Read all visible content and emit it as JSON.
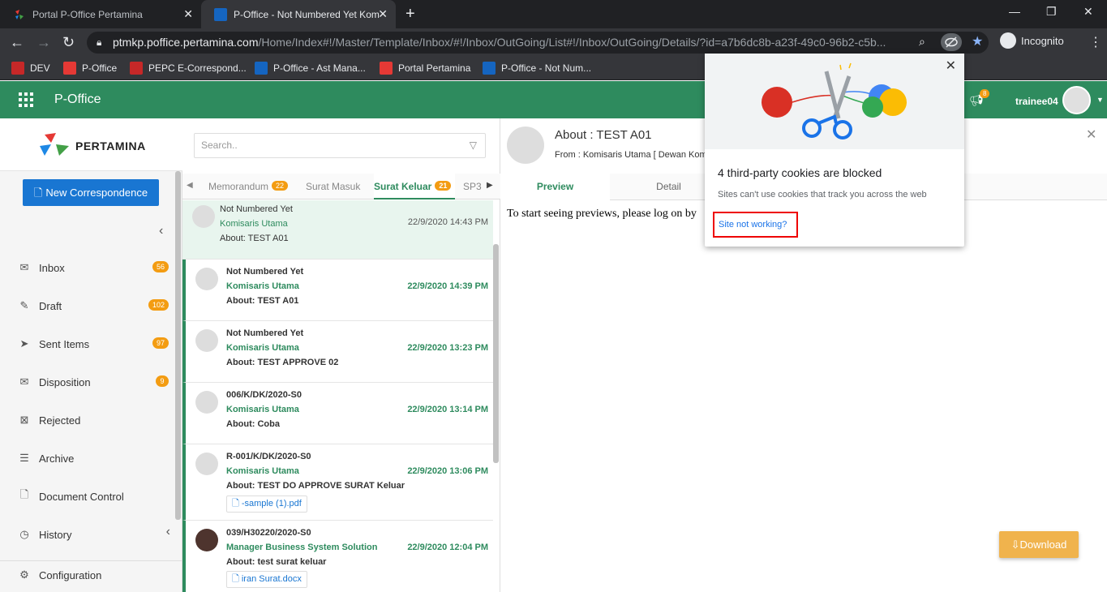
{
  "browser": {
    "tabs": [
      {
        "label": "Portal P-Office Pertamina"
      },
      {
        "label": "P-Office - Not Numbered Yet Kom"
      }
    ],
    "url_host": "ptmkp.poffice.pertamina.com",
    "url_path": "/Home/Index#!/Master/Template/Inbox/#!/Inbox/OutGoing/List#!/Inbox/OutGoing/Details/?id=a7b6dc8b-a23f-49c0-96b2-c5b...",
    "incognito_label": "Incognito",
    "bookmarks": [
      {
        "label": "DEV",
        "color": "#c62828"
      },
      {
        "label": "P-Office",
        "color": "#e53935"
      },
      {
        "label": "PEPC E-Correspond...",
        "color": "#c62828"
      },
      {
        "label": "P-Office - Ast Mana...",
        "color": "#1565c0"
      },
      {
        "label": "Portal Pertamina",
        "color": "#e53935"
      },
      {
        "label": "P-Office - Not Num...",
        "color": "#1565c0"
      }
    ]
  },
  "app": {
    "title": "P-Office",
    "notification_count": "8",
    "username": "trainee04",
    "brand_color": "#2e8b5e"
  },
  "sidebar": {
    "logo_text": "PERTAMINA",
    "new_button": "New Correspondence",
    "items": [
      {
        "label": "Inbox",
        "badge": "56",
        "icon": "inbox-icon"
      },
      {
        "label": "Draft",
        "badge": "102",
        "icon": "draft-icon"
      },
      {
        "label": "Sent Items",
        "badge": "97",
        "icon": "sent-icon"
      },
      {
        "label": "Disposition",
        "badge": "9",
        "icon": "disposition-icon"
      },
      {
        "label": "Rejected",
        "badge": "",
        "icon": "rejected-icon"
      },
      {
        "label": "Archive",
        "badge": "",
        "icon": "archive-icon"
      },
      {
        "label": "Document Control",
        "badge": "",
        "icon": "document-icon"
      },
      {
        "label": "History",
        "badge": "",
        "icon": "history-icon"
      },
      {
        "label": "Configuration",
        "badge": "",
        "icon": "gear-icon"
      }
    ]
  },
  "list": {
    "search_placeholder": "Search..",
    "tabs": [
      {
        "label": "Memorandum",
        "badge": "22"
      },
      {
        "label": "Surat Masuk",
        "badge": ""
      },
      {
        "label": "Surat Keluar",
        "badge": "21"
      },
      {
        "label": "SP3",
        "badge": ""
      }
    ],
    "items": [
      {
        "number": "Not Numbered Yet",
        "from": "Komisaris Utama",
        "about": "About: TEST A01",
        "date": "22/9/2020 14:43 PM",
        "attachment": ""
      },
      {
        "number": "Not Numbered Yet",
        "from": "Komisaris Utama",
        "about": "About: TEST A01",
        "date": "22/9/2020 14:39 PM",
        "attachment": ""
      },
      {
        "number": "Not Numbered Yet",
        "from": "Komisaris Utama",
        "about": "About: TEST APPROVE 02",
        "date": "22/9/2020 13:23 PM",
        "attachment": ""
      },
      {
        "number": "006/K/DK/2020-S0",
        "from": "Komisaris Utama",
        "about": "About: Coba",
        "date": "22/9/2020 13:14 PM",
        "attachment": ""
      },
      {
        "number": "R-001/K/DK/2020-S0",
        "from": "Komisaris Utama",
        "about": "About: TEST DO APPROVE SURAT Keluar",
        "date": "22/9/2020 13:06 PM",
        "attachment": "-sample (1).pdf"
      },
      {
        "number": "039/H30220/2020-S0",
        "from": "Manager Business System Solution",
        "about": "About: test surat keluar",
        "date": "22/9/2020 12:04 PM",
        "attachment": "iran Surat.docx"
      }
    ]
  },
  "detail": {
    "title": "About : TEST A01",
    "from": "From : Komisaris Utama [ Dewan Kom",
    "tabs": [
      "Preview",
      "Detail"
    ],
    "preview_text": "To start seeing previews, please log on by",
    "download_label": "Download"
  },
  "cookie_popup": {
    "title": "4 third-party cookies are blocked",
    "subtitle": "Sites can't use cookies that track you across the web",
    "link": "Site not working?"
  }
}
